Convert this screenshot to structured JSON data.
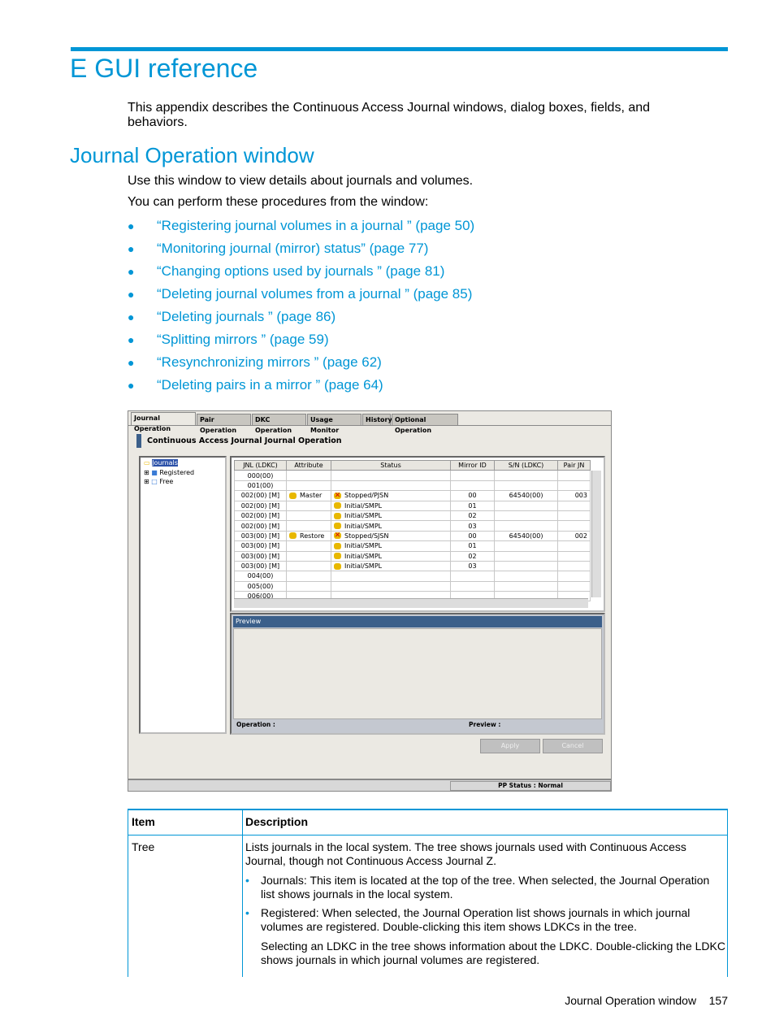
{
  "chapter": {
    "title": "E GUI reference",
    "intro": "This appendix describes the Continuous Access Journal windows, dialog boxes, fields, and behaviors."
  },
  "section": {
    "title": "Journal Operation window",
    "p1": "Use this window to view details about journals and volumes.",
    "p2": "You can perform these procedures from the window:",
    "links": [
      "“Registering journal volumes in a journal ” (page 50)",
      "“Monitoring journal (mirror) status” (page 77)",
      "“Changing options used by journals ” (page 81)",
      "“Deleting journal volumes from a journal ” (page 85)",
      "“Deleting journals ” (page 86)",
      "“Splitting mirrors ” (page 59)",
      "“Resynchronizing mirrors ” (page 62)",
      "“Deleting pairs in a mirror ” (page 64)"
    ]
  },
  "screenshot": {
    "tabs": [
      "Journal Operation",
      "Pair Operation",
      "DKC Operation",
      "Usage Monitor",
      "History",
      "Optional Operation"
    ],
    "heading": "Continuous Access Journal Journal Operation",
    "tree": [
      "Journals",
      "Registered",
      "Free"
    ],
    "columns": [
      "JNL (LDKC)",
      "Attribute",
      "Status",
      "Mirror ID",
      "S/N (LDKC)",
      "Pair JN"
    ],
    "rows": [
      [
        "000(00)",
        "",
        "",
        "",
        "",
        ""
      ],
      [
        "001(00)",
        "",
        "",
        "",
        "",
        ""
      ],
      [
        "002(00) [M]",
        "Master",
        "Stopped/PJSN",
        "00",
        "64540(00)",
        "003"
      ],
      [
        "002(00) [M]",
        "",
        "Initial/SMPL",
        "01",
        "",
        ""
      ],
      [
        "002(00) [M]",
        "",
        "Initial/SMPL",
        "02",
        "",
        ""
      ],
      [
        "002(00) [M]",
        "",
        "Initial/SMPL",
        "03",
        "",
        ""
      ],
      [
        "003(00) [M]",
        "Restore",
        "Stopped/SJSN",
        "00",
        "64540(00)",
        "002"
      ],
      [
        "003(00) [M]",
        "",
        "Initial/SMPL",
        "01",
        "",
        ""
      ],
      [
        "003(00) [M]",
        "",
        "Initial/SMPL",
        "02",
        "",
        ""
      ],
      [
        "003(00) [M]",
        "",
        "Initial/SMPL",
        "03",
        "",
        ""
      ],
      [
        "004(00)",
        "",
        "",
        "",
        "",
        ""
      ],
      [
        "005(00)",
        "",
        "",
        "",
        "",
        ""
      ],
      [
        "006(00)",
        "",
        "",
        "",
        "",
        ""
      ]
    ],
    "preview_title": "Preview",
    "operation_label": "Operation :",
    "preview_label": "Preview :",
    "apply": "Apply",
    "cancel": "Cancel",
    "pp_status": "PP Status : Normal"
  },
  "table": {
    "headers": [
      "Item",
      "Description"
    ],
    "item": "Tree",
    "desc": "Lists journals in the local system. The tree shows journals used with Continuous Access Journal, though not Continuous Access Journal Z.",
    "bullets": [
      "Journals: This item is located at the top of the tree. When selected, the Journal Operation list shows journals in the local system.",
      "Registered: When selected, the Journal Operation list shows journals in which journal volumes are registered. Double-clicking this item shows LDKCs in the tree."
    ],
    "extra": "Selecting an LDKC in the tree shows information about the LDKC. Double-clicking the LDKC shows journals in which journal volumes are registered."
  },
  "footer": {
    "section": "Journal Operation window",
    "page": "157"
  },
  "colors": {
    "accent": "#0096d6",
    "panel_title": "#3b5f8a"
  }
}
